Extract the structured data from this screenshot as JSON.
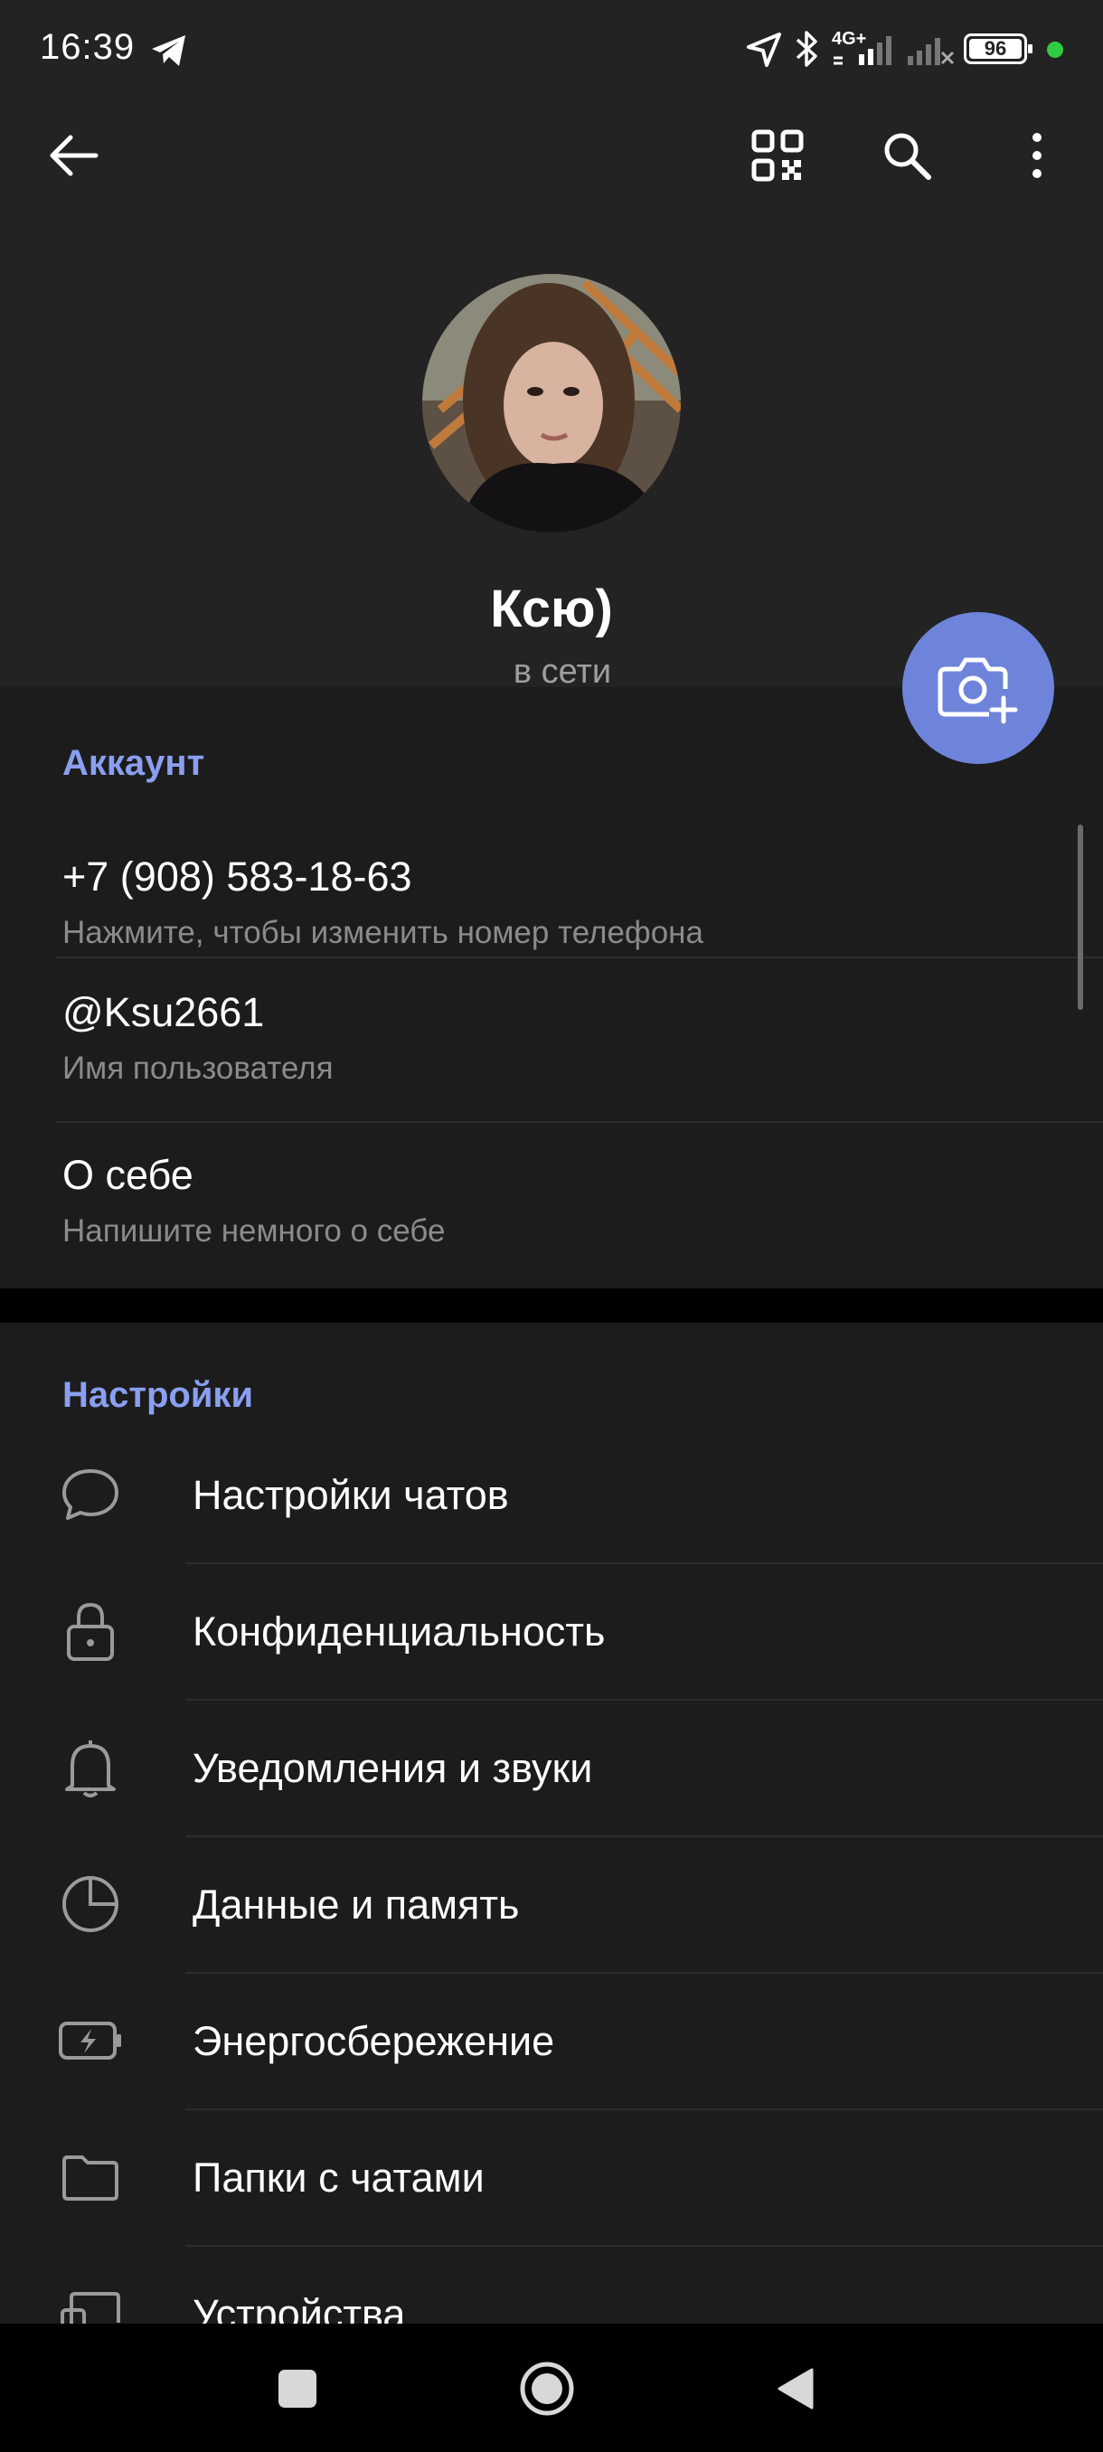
{
  "status_bar": {
    "time": "16:39",
    "network": "4G+",
    "battery": "96",
    "icons": [
      "telegram-icon",
      "location-icon",
      "bluetooth-icon",
      "signal-icon",
      "signal-icon",
      "battery-icon"
    ]
  },
  "header": {
    "back_icon": "arrow-left-icon",
    "actions": [
      "qr-code-icon",
      "search-icon",
      "more-vertical-icon"
    ]
  },
  "profile": {
    "name": "Ксю)",
    "status": "в сети"
  },
  "fab": {
    "icon": "camera-add-icon",
    "color": "#6e84db"
  },
  "account": {
    "title": "Аккаунт",
    "rows": [
      {
        "primary": "+7 (908) 583-18-63",
        "secondary": "Нажмите, чтобы изменить номер телефона"
      },
      {
        "primary": "@Ksu2661",
        "secondary": "Имя пользователя"
      },
      {
        "primary": "О себе",
        "secondary": "Напишите немного о себе"
      }
    ]
  },
  "settings": {
    "title": "Настройки",
    "items": [
      {
        "label": "Настройки чатов",
        "icon": "chat-bubble-icon"
      },
      {
        "label": "Конфиденциальность",
        "icon": "lock-icon"
      },
      {
        "label": "Уведомления и звуки",
        "icon": "bell-icon"
      },
      {
        "label": "Данные и память",
        "icon": "clock-pie-icon"
      },
      {
        "label": "Энергосбережение",
        "icon": "battery-bolt-icon"
      },
      {
        "label": "Папки с чатами",
        "icon": "folder-icon"
      },
      {
        "label": "Устройства",
        "icon": "devices-icon"
      }
    ]
  },
  "nav_bar": {
    "icons": [
      "recents-square-icon",
      "home-circle-icon",
      "back-triangle-icon"
    ]
  },
  "colors": {
    "accent": "#8a9ff0",
    "fab": "#6e84db",
    "background": "#1c1c1d",
    "header": "#232323",
    "online_dot": "#2ecc40"
  }
}
